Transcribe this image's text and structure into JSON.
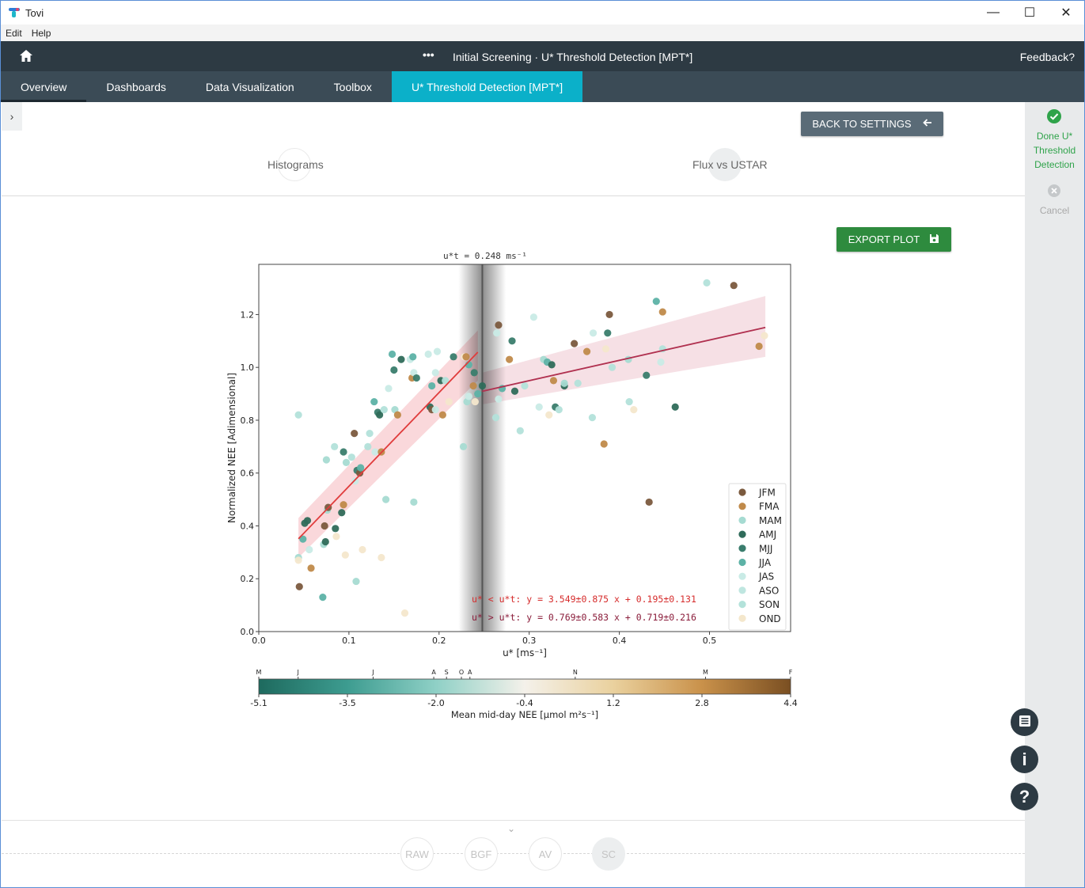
{
  "window": {
    "title": "Tovi",
    "controls": {
      "minimize": "—",
      "maximize": "☐",
      "close": "✕"
    }
  },
  "menu": [
    {
      "label": "Edit"
    },
    {
      "label": "Help"
    }
  ],
  "header": {
    "dots": "•••",
    "title": "Initial Screening · U* Threshold Detection [MPT*]",
    "feedback": "Feedback?"
  },
  "tabs": [
    {
      "label": "Overview"
    },
    {
      "label": "Dashboards"
    },
    {
      "label": "Data Visualization"
    },
    {
      "label": "Toolbox"
    },
    {
      "label": "U* Threshold Detection [MPT*]"
    }
  ],
  "sidebar": {
    "toggle": "›",
    "done_label": "Done U* Threshold Detection",
    "cancel_label": "Cancel"
  },
  "buttons": {
    "back": "BACK TO SETTINGS",
    "export": "EXPORT PLOT"
  },
  "steps": {
    "histograms": "Histograms",
    "flux": "Flux vs USTAR"
  },
  "fab": {
    "notes": "",
    "info": "i",
    "help": "?"
  },
  "pipeline": [
    {
      "label": "RAW"
    },
    {
      "label": "BGF"
    },
    {
      "label": "AV"
    },
    {
      "label": "SC"
    }
  ],
  "bottom_chevron": "⌄",
  "colors": {
    "header": "#2d3a43",
    "tabs": "#3b4b56",
    "active_tab": "#0bb0c9",
    "done": "#2fa34a",
    "export": "#2e8b3e",
    "back": "#5a6b77",
    "fit_low": "#e03c3c",
    "fit_high": "#b0304f"
  },
  "chart_data": {
    "type": "scatter",
    "title": "u*t = 0.248 ms⁻¹",
    "xlabel": "u* [ms⁻¹]",
    "ylabel": "Normalized NEE [Adimensional]",
    "xlim": [
      0.0,
      0.59
    ],
    "ylim": [
      0.0,
      1.39
    ],
    "xticks": [
      0.0,
      0.1,
      0.2,
      0.3,
      0.4,
      0.5
    ],
    "yticks": [
      0.0,
      0.2,
      0.4,
      0.6,
      0.8,
      1.0,
      1.2
    ],
    "xtick_labels": [
      "0.0",
      "0.1",
      "0.2",
      "0.3",
      "0.4",
      "0.5"
    ],
    "ytick_labels": [
      "0.0",
      "0.2",
      "0.4",
      "0.6",
      "0.8",
      "1.0",
      "1.2"
    ],
    "threshold": 0.248,
    "legend_position": "lower-right",
    "legend": [
      {
        "name": "JFM",
        "color": "#7b5a3e"
      },
      {
        "name": "FMA",
        "color": "#c08a4a"
      },
      {
        "name": "MAM",
        "color": "#a6dbd2"
      },
      {
        "name": "AMJ",
        "color": "#2f6b5a"
      },
      {
        "name": "MJJ",
        "color": "#3a7d6d"
      },
      {
        "name": "JJA",
        "color": "#5db2a6"
      },
      {
        "name": "JAS",
        "color": "#c9ebe6"
      },
      {
        "name": "ASO",
        "color": "#bfe6e0"
      },
      {
        "name": "SON",
        "color": "#b3e2da"
      },
      {
        "name": "OND",
        "color": "#f4e7cc"
      }
    ],
    "fits": [
      {
        "label": "u* < u*t:  y = 3.549±0.875  x + 0.195±0.131",
        "slope": 3.549,
        "intercept": 0.195,
        "x_range": [
          0.044,
          0.243
        ],
        "band_low": [
          0.28,
          0.95
        ],
        "band_high": [
          0.43,
          1.14
        ],
        "color": "#e03c3c"
      },
      {
        "label": "u* > u*t:  y = 0.769±0.583  x + 0.719±0.216",
        "slope": 0.769,
        "intercept": 0.719,
        "x_range": [
          0.248,
          0.562
        ],
        "band_low": [
          0.86,
          1.04
        ],
        "band_high": [
          0.98,
          1.27
        ],
        "color": "#b0304f"
      }
    ],
    "points": [
      {
        "x": 0.044,
        "y": 0.82,
        "c": "#b3e2da"
      },
      {
        "x": 0.044,
        "y": 0.28,
        "c": "#a6dbd2"
      },
      {
        "x": 0.044,
        "y": 0.27,
        "c": "#f4e7cc"
      },
      {
        "x": 0.045,
        "y": 0.17,
        "c": "#7b5a3e"
      },
      {
        "x": 0.049,
        "y": 0.35,
        "c": "#5db2a6"
      },
      {
        "x": 0.051,
        "y": 0.41,
        "c": "#2f6b5a"
      },
      {
        "x": 0.054,
        "y": 0.42,
        "c": "#2f6b5a"
      },
      {
        "x": 0.056,
        "y": 0.31,
        "c": "#c9ebe6"
      },
      {
        "x": 0.058,
        "y": 0.24,
        "c": "#c08a4a"
      },
      {
        "x": 0.071,
        "y": 0.13,
        "c": "#5db2a6"
      },
      {
        "x": 0.072,
        "y": 0.33,
        "c": "#a6dbd2"
      },
      {
        "x": 0.073,
        "y": 0.4,
        "c": "#7b5a3e"
      },
      {
        "x": 0.074,
        "y": 0.34,
        "c": "#2f6b5a"
      },
      {
        "x": 0.075,
        "y": 0.65,
        "c": "#a6dbd2"
      },
      {
        "x": 0.076,
        "y": 0.46,
        "c": "#a6dbd2"
      },
      {
        "x": 0.077,
        "y": 0.47,
        "c": "#7b5a3e"
      },
      {
        "x": 0.084,
        "y": 0.7,
        "c": "#b3e2da"
      },
      {
        "x": 0.085,
        "y": 0.39,
        "c": "#2f6b5a"
      },
      {
        "x": 0.086,
        "y": 0.36,
        "c": "#f4e7cc"
      },
      {
        "x": 0.092,
        "y": 0.45,
        "c": "#2f6b5a"
      },
      {
        "x": 0.094,
        "y": 0.48,
        "c": "#c08a4a"
      },
      {
        "x": 0.094,
        "y": 0.68,
        "c": "#3a7d6d"
      },
      {
        "x": 0.096,
        "y": 0.29,
        "c": "#f4e7cc"
      },
      {
        "x": 0.097,
        "y": 0.64,
        "c": "#a6dbd2"
      },
      {
        "x": 0.103,
        "y": 0.66,
        "c": "#b3e2da"
      },
      {
        "x": 0.106,
        "y": 0.75,
        "c": "#7b5a3e"
      },
      {
        "x": 0.107,
        "y": 0.57,
        "c": "#c9ebe6"
      },
      {
        "x": 0.108,
        "y": 0.19,
        "c": "#a6dbd2"
      },
      {
        "x": 0.109,
        "y": 0.61,
        "c": "#3a7d6d"
      },
      {
        "x": 0.112,
        "y": 0.6,
        "c": "#7b5a3e"
      },
      {
        "x": 0.113,
        "y": 0.62,
        "c": "#5db2a6"
      },
      {
        "x": 0.115,
        "y": 0.31,
        "c": "#f4e7cc"
      },
      {
        "x": 0.121,
        "y": 0.7,
        "c": "#b3e2da"
      },
      {
        "x": 0.123,
        "y": 0.75,
        "c": "#b3e2da"
      },
      {
        "x": 0.128,
        "y": 0.87,
        "c": "#5db2a6"
      },
      {
        "x": 0.129,
        "y": 0.68,
        "c": "#c9ebe6"
      },
      {
        "x": 0.132,
        "y": 0.83,
        "c": "#3a7d6d"
      },
      {
        "x": 0.134,
        "y": 0.82,
        "c": "#2f6b5a"
      },
      {
        "x": 0.136,
        "y": 0.28,
        "c": "#f4e7cc"
      },
      {
        "x": 0.136,
        "y": 0.68,
        "c": "#c08a4a"
      },
      {
        "x": 0.139,
        "y": 0.84,
        "c": "#b3e2da"
      },
      {
        "x": 0.141,
        "y": 0.5,
        "c": "#a6dbd2"
      },
      {
        "x": 0.144,
        "y": 0.92,
        "c": "#c9ebe6"
      },
      {
        "x": 0.148,
        "y": 1.05,
        "c": "#5db2a6"
      },
      {
        "x": 0.15,
        "y": 0.99,
        "c": "#3a7d6d"
      },
      {
        "x": 0.151,
        "y": 0.84,
        "c": "#a6dbd2"
      },
      {
        "x": 0.154,
        "y": 0.82,
        "c": "#c08a4a"
      },
      {
        "x": 0.158,
        "y": 1.03,
        "c": "#2f6b5a"
      },
      {
        "x": 0.162,
        "y": 0.07,
        "c": "#f4e7cc"
      },
      {
        "x": 0.168,
        "y": 1.03,
        "c": "#c9ebe6"
      },
      {
        "x": 0.17,
        "y": 0.96,
        "c": "#c08a4a"
      },
      {
        "x": 0.171,
        "y": 1.04,
        "c": "#5db2a6"
      },
      {
        "x": 0.172,
        "y": 0.49,
        "c": "#a6dbd2"
      },
      {
        "x": 0.172,
        "y": 0.98,
        "c": "#c9ebe6"
      },
      {
        "x": 0.175,
        "y": 0.96,
        "c": "#3a7d6d"
      },
      {
        "x": 0.188,
        "y": 1.05,
        "c": "#c9ebe6"
      },
      {
        "x": 0.19,
        "y": 0.85,
        "c": "#2f6b5a"
      },
      {
        "x": 0.192,
        "y": 0.84,
        "c": "#7b5a3e"
      },
      {
        "x": 0.192,
        "y": 0.93,
        "c": "#5db2a6"
      },
      {
        "x": 0.196,
        "y": 0.84,
        "c": "#c9ebe6"
      },
      {
        "x": 0.196,
        "y": 0.98,
        "c": "#c9ebe6"
      },
      {
        "x": 0.198,
        "y": 1.06,
        "c": "#c9ebe6"
      },
      {
        "x": 0.202,
        "y": 0.95,
        "c": "#2f6b5a"
      },
      {
        "x": 0.204,
        "y": 0.82,
        "c": "#c08a4a"
      },
      {
        "x": 0.207,
        "y": 0.95,
        "c": "#b3e2da"
      },
      {
        "x": 0.211,
        "y": 0.87,
        "c": "#f4e7cc"
      },
      {
        "x": 0.216,
        "y": 1.04,
        "c": "#3a7d6d"
      },
      {
        "x": 0.227,
        "y": 0.7,
        "c": "#a6dbd2"
      },
      {
        "x": 0.228,
        "y": 1.04,
        "c": "#f4e7cc"
      },
      {
        "x": 0.23,
        "y": 1.04,
        "c": "#c08a4a"
      },
      {
        "x": 0.231,
        "y": 0.87,
        "c": "#a6dbd2"
      },
      {
        "x": 0.233,
        "y": 1.01,
        "c": "#5db2a6"
      },
      {
        "x": 0.233,
        "y": 0.89,
        "c": "#c9ebe6"
      },
      {
        "x": 0.238,
        "y": 0.93,
        "c": "#c08a4a"
      },
      {
        "x": 0.239,
        "y": 0.98,
        "c": "#3a7d6d"
      },
      {
        "x": 0.24,
        "y": 0.87,
        "c": "#f4e7cc"
      },
      {
        "x": 0.243,
        "y": 0.9,
        "c": "#5db2a6"
      },
      {
        "x": 0.248,
        "y": 0.93,
        "c": "#2f6b5a"
      },
      {
        "x": 0.263,
        "y": 0.81,
        "c": "#b3e2da"
      },
      {
        "x": 0.264,
        "y": 1.13,
        "c": "#c9ebe6"
      },
      {
        "x": 0.266,
        "y": 1.16,
        "c": "#7b5a3e"
      },
      {
        "x": 0.266,
        "y": 0.88,
        "c": "#c9ebe6"
      },
      {
        "x": 0.27,
        "y": 0.92,
        "c": "#5db2a6"
      },
      {
        "x": 0.278,
        "y": 1.03,
        "c": "#c08a4a"
      },
      {
        "x": 0.281,
        "y": 1.1,
        "c": "#3a7d6d"
      },
      {
        "x": 0.284,
        "y": 0.91,
        "c": "#2f6b5a"
      },
      {
        "x": 0.29,
        "y": 0.76,
        "c": "#b3e2da"
      },
      {
        "x": 0.295,
        "y": 0.93,
        "c": "#b3e2da"
      },
      {
        "x": 0.305,
        "y": 1.19,
        "c": "#c9ebe6"
      },
      {
        "x": 0.311,
        "y": 0.85,
        "c": "#c9ebe6"
      },
      {
        "x": 0.316,
        "y": 1.03,
        "c": "#a6dbd2"
      },
      {
        "x": 0.32,
        "y": 1.02,
        "c": "#5db2a6"
      },
      {
        "x": 0.322,
        "y": 0.82,
        "c": "#f4e7cc"
      },
      {
        "x": 0.325,
        "y": 1.01,
        "c": "#2f6b5a"
      },
      {
        "x": 0.327,
        "y": 0.95,
        "c": "#c08a4a"
      },
      {
        "x": 0.329,
        "y": 0.85,
        "c": "#3a7d6d"
      },
      {
        "x": 0.333,
        "y": 0.84,
        "c": "#b3e2da"
      },
      {
        "x": 0.339,
        "y": 0.93,
        "c": "#2f6b5a"
      },
      {
        "x": 0.339,
        "y": 0.94,
        "c": "#a6dbd2"
      },
      {
        "x": 0.35,
        "y": 1.09,
        "c": "#7b5a3e"
      },
      {
        "x": 0.354,
        "y": 0.94,
        "c": "#b3e2da"
      },
      {
        "x": 0.364,
        "y": 1.06,
        "c": "#c08a4a"
      },
      {
        "x": 0.37,
        "y": 0.81,
        "c": "#b3e2da"
      },
      {
        "x": 0.371,
        "y": 1.13,
        "c": "#c9ebe6"
      },
      {
        "x": 0.383,
        "y": 0.71,
        "c": "#c08a4a"
      },
      {
        "x": 0.385,
        "y": 1.07,
        "c": "#f4e7cc"
      },
      {
        "x": 0.387,
        "y": 1.13,
        "c": "#3a7d6d"
      },
      {
        "x": 0.389,
        "y": 1.2,
        "c": "#7b5a3e"
      },
      {
        "x": 0.392,
        "y": 1.0,
        "c": "#b3e2da"
      },
      {
        "x": 0.41,
        "y": 1.03,
        "c": "#a6dbd2"
      },
      {
        "x": 0.411,
        "y": 0.87,
        "c": "#b3e2da"
      },
      {
        "x": 0.416,
        "y": 0.84,
        "c": "#f4e7cc"
      },
      {
        "x": 0.43,
        "y": 0.97,
        "c": "#3a7d6d"
      },
      {
        "x": 0.433,
        "y": 0.49,
        "c": "#7b5a3e"
      },
      {
        "x": 0.441,
        "y": 1.25,
        "c": "#5db2a6"
      },
      {
        "x": 0.448,
        "y": 1.21,
        "c": "#c08a4a"
      },
      {
        "x": 0.446,
        "y": 1.02,
        "c": "#c9ebe6"
      },
      {
        "x": 0.448,
        "y": 1.07,
        "c": "#b3e2da"
      },
      {
        "x": 0.462,
        "y": 0.85,
        "c": "#2f6b5a"
      },
      {
        "x": 0.497,
        "y": 1.32,
        "c": "#b3e2da"
      },
      {
        "x": 0.527,
        "y": 1.31,
        "c": "#7b5a3e"
      },
      {
        "x": 0.555,
        "y": 1.08,
        "c": "#c08a4a"
      },
      {
        "x": 0.561,
        "y": 1.12,
        "c": "#f4e7cc"
      }
    ],
    "colorbar": {
      "label": "Mean mid-day NEE [µmol m²s⁻¹]",
      "tick_labels": [
        "-5.1",
        "-3.5",
        "-2.0",
        "-0.4",
        "1.2",
        "2.8",
        "4.4"
      ],
      "top_labels": [
        "M",
        "J",
        "J",
        "A",
        "S",
        "O",
        "A",
        "N",
        "M",
        "F"
      ],
      "top_positions": [
        0.0,
        0.074,
        0.215,
        0.329,
        0.353,
        0.381,
        0.397,
        0.595,
        0.84,
        1.0
      ],
      "stops": [
        "#1e6a5e",
        "#3d9c90",
        "#8fd0c6",
        "#f4f1ea",
        "#ead19e",
        "#c9914a",
        "#7a4f22"
      ]
    }
  }
}
